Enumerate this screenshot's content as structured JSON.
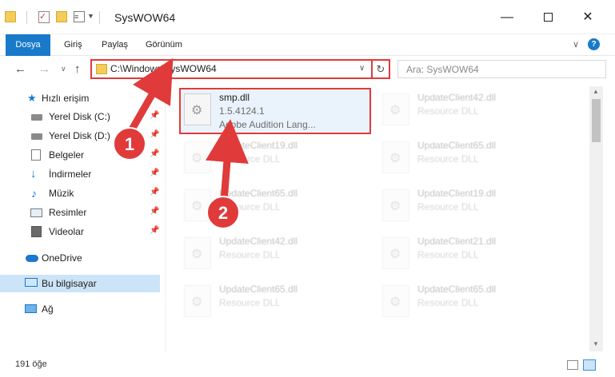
{
  "window": {
    "title": "SysWOW64",
    "minimize": "—",
    "close": "✕"
  },
  "ribbon": {
    "tabs": [
      "Dosya",
      "Giriş",
      "Paylaş",
      "Görünüm"
    ],
    "collapse": "∨",
    "help": "?"
  },
  "nav": {
    "back": "←",
    "forward": "→",
    "recent": "∨",
    "up": "↑",
    "address": "C:\\Windows\\SysWOW64",
    "refresh": "↻",
    "search_placeholder": "Ara: SysWOW64"
  },
  "sidebar": {
    "quick_access": "Hızlı erişim",
    "items": [
      {
        "label": "Yerel Disk (C:)",
        "icon": "drive-icon",
        "pinned": true
      },
      {
        "label": "Yerel Disk (D:)",
        "icon": "drive-icon",
        "pinned": true
      },
      {
        "label": "Belgeler",
        "icon": "documents-icon",
        "pinned": true
      },
      {
        "label": "İndirmeler",
        "icon": "downloads-icon",
        "pinned": true
      },
      {
        "label": "Müzik",
        "icon": "music-icon",
        "pinned": true
      },
      {
        "label": "Resimler",
        "icon": "pictures-icon",
        "pinned": true
      },
      {
        "label": "Videolar",
        "icon": "videos-icon",
        "pinned": true
      }
    ],
    "onedrive": "OneDrive",
    "this_pc": "Bu bilgisayar",
    "network": "Ağ"
  },
  "files": [
    {
      "name": "smp.dll",
      "line1": "1.5.4124.1",
      "line2": "Adobe Audition Lang...",
      "highlighted": true
    },
    {
      "name": "UpdateClient42.dll",
      "line1": "Resource DLL",
      "line2": ""
    },
    {
      "name": "UpdateClient19.dll",
      "line1": "Resource DLL",
      "line2": ""
    },
    {
      "name": "UpdateClient65.dll",
      "line1": "Resource DLL",
      "line2": ""
    },
    {
      "name": "UpdateClient65.dll",
      "line1": "Resource DLL",
      "line2": ""
    },
    {
      "name": "UpdateClient19.dll",
      "line1": "Resource DLL",
      "line2": ""
    },
    {
      "name": "UpdateClient42.dll",
      "line1": "Resource DLL",
      "line2": ""
    },
    {
      "name": "UpdateClient21.dll",
      "line1": "Resource DLL",
      "line2": ""
    },
    {
      "name": "UpdateClient65.dll",
      "line1": "Resource DLL",
      "line2": ""
    },
    {
      "name": "UpdateClient65.dll",
      "line1": "Resource DLL",
      "line2": ""
    }
  ],
  "status": {
    "count": "191 öğe"
  },
  "annotations": {
    "step1": "1",
    "step2": "2",
    "color": "#e03a3a"
  }
}
